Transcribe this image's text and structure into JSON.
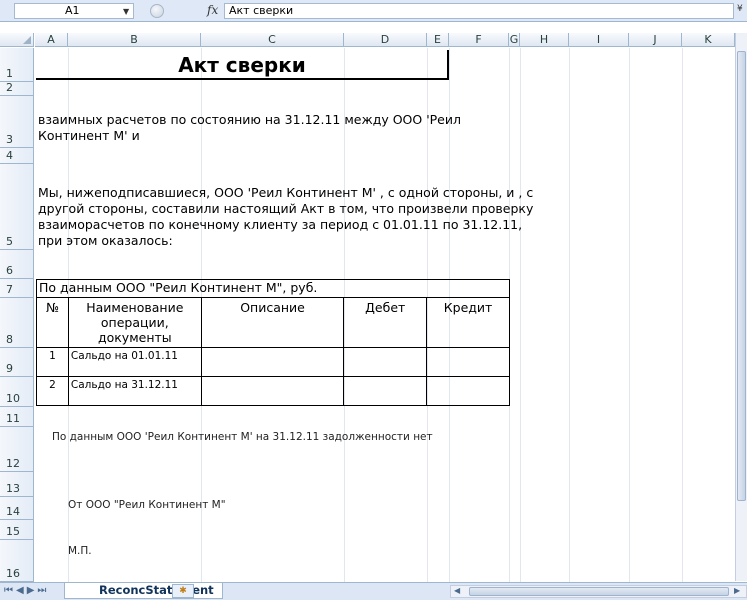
{
  "formula_bar": {
    "name_box": "A1",
    "fx_label": "fx",
    "content": "Акт сверки"
  },
  "columns": [
    "A",
    "B",
    "C",
    "D",
    "E",
    "F",
    "G",
    "H",
    "I",
    "J",
    "K"
  ],
  "rows": [
    "1",
    "2",
    "3",
    "4",
    "5",
    "6",
    "7",
    "8",
    "9",
    "10",
    "11",
    "12",
    "13",
    "14",
    "15",
    "16"
  ],
  "sheet": {
    "title": "Акт сверки",
    "line_3": "взаимных расчетов по состоянию на 31.12.11 между ООО 'Реил Континент М' и",
    "line_5": "Мы, нижеподписавшиеся, ООО 'Реил Континент М' , с одной стороны, и , с другой стороны, составили настоящий Акт  в том, что произвели проверку взаиморасчетов по конечному клиенту за период с 01.01.11 по 31.12.11, при этом оказалось:",
    "table": {
      "caption": "По данным ООО \"Реил Континент М\", руб.",
      "headers": [
        "№",
        "Наименование операции, документы",
        "Описание",
        "Дебет",
        "Кредит"
      ],
      "rows": [
        {
          "num": "1",
          "name": "Сальдо на 01.01.11",
          "desc": "",
          "debit": "",
          "credit": ""
        },
        {
          "num": "2",
          "name": "Сальдо на 31.12.11",
          "desc": "",
          "debit": "",
          "credit": ""
        }
      ]
    },
    "line_12": "По данным ООО 'Реил Континент М' на 31.12.11 задолженности нет",
    "line_14": "От ООО \"Реил Континент М\"",
    "line_16": "М.П."
  },
  "tabs": {
    "active": "ReconcStatement"
  }
}
